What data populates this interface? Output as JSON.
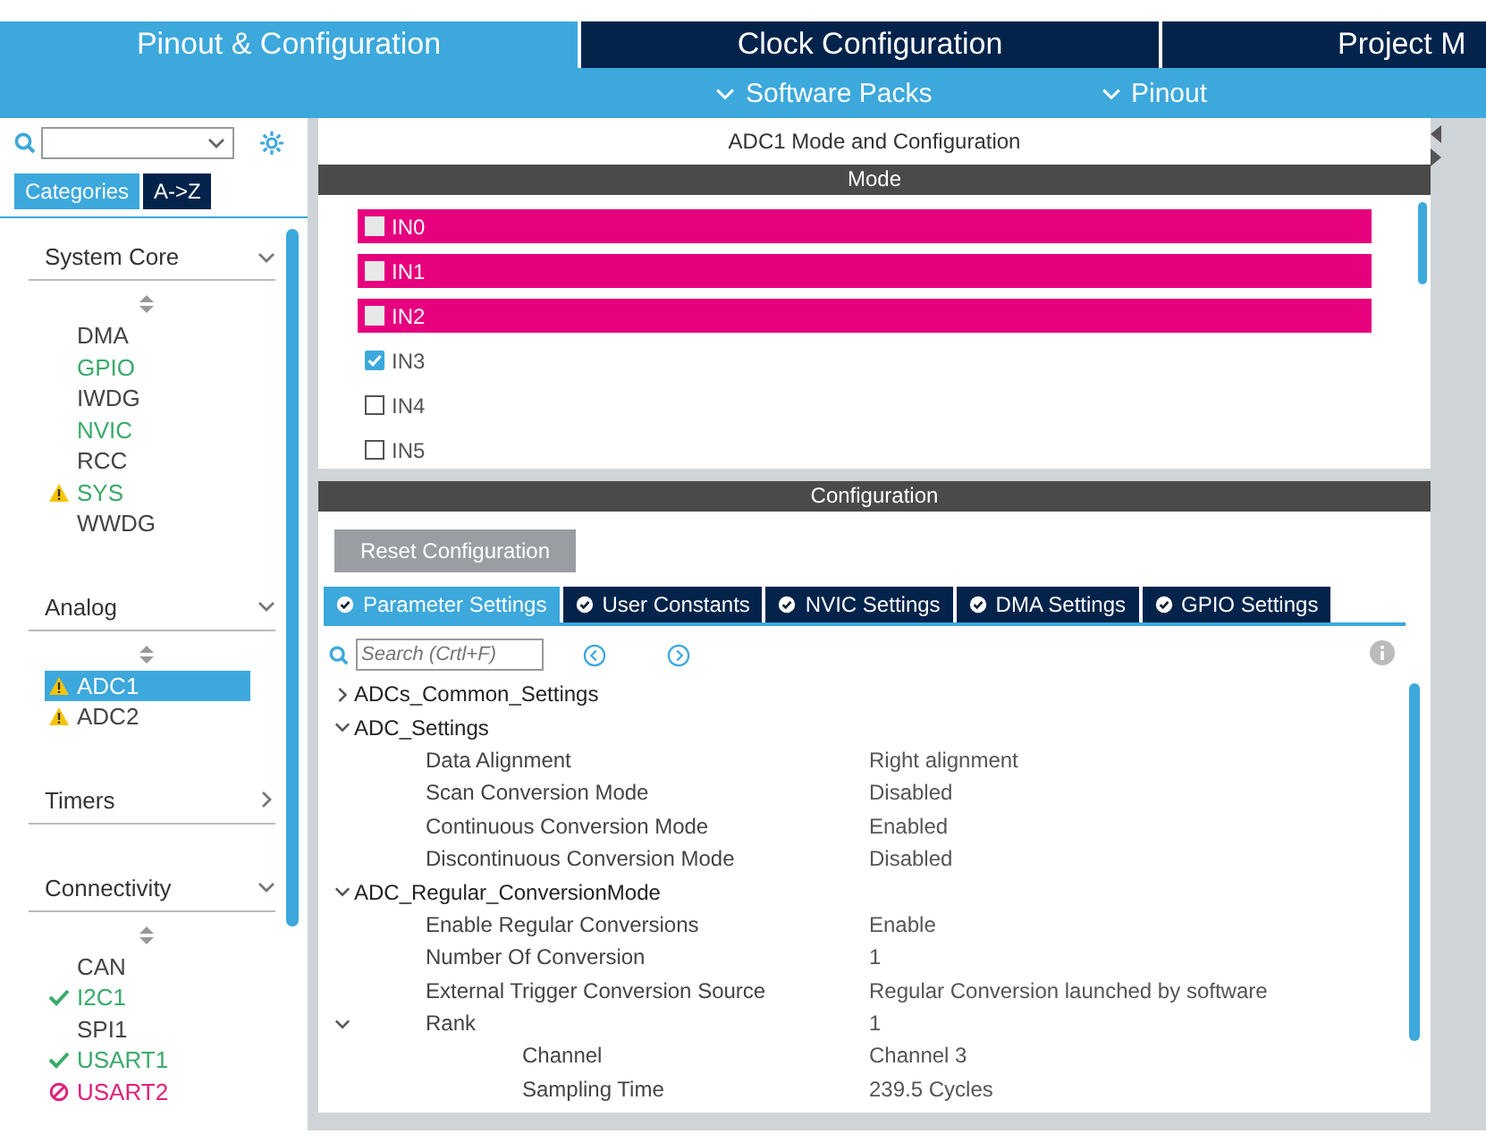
{
  "top_tabs": [
    {
      "label": "Pinout & Configuration",
      "selected": true
    },
    {
      "label": "Clock Configuration",
      "selected": false
    },
    {
      "label": "Project M",
      "selected": false
    }
  ],
  "sub_menu": [
    "Software Packs",
    "Pinout"
  ],
  "sidebar": {
    "view_tabs": [
      {
        "label": "Categories",
        "selected": true
      },
      {
        "label": "A->Z",
        "selected": false
      }
    ],
    "groups": [
      {
        "title": "System Core",
        "expanded": true,
        "items": [
          {
            "label": "DMA",
            "kind": "plain",
            "color": "#444444",
            "selected": false
          },
          {
            "label": "GPIO",
            "kind": "plain",
            "color": "#3aaa6a",
            "selected": false
          },
          {
            "label": "IWDG",
            "kind": "plain",
            "color": "#444444",
            "selected": false
          },
          {
            "label": "NVIC",
            "kind": "plain",
            "color": "#3aaa6a",
            "selected": false
          },
          {
            "label": "RCC",
            "kind": "plain",
            "color": "#444444",
            "selected": false
          },
          {
            "label": "SYS",
            "kind": "warning",
            "color": "#3aaa6a",
            "selected": false
          },
          {
            "label": "WWDG",
            "kind": "plain",
            "color": "#444444",
            "selected": false
          }
        ]
      },
      {
        "title": "Analog",
        "expanded": true,
        "items": [
          {
            "label": "ADC1",
            "kind": "warning",
            "color": "#ffffff",
            "selected": true
          },
          {
            "label": "ADC2",
            "kind": "warning",
            "color": "#444444",
            "selected": false
          }
        ]
      },
      {
        "title": "Timers",
        "expanded": false
      },
      {
        "title": "Connectivity",
        "expanded": true,
        "items": [
          {
            "label": "CAN",
            "kind": "plain",
            "color": "#444444",
            "selected": false
          },
          {
            "label": "I2C1",
            "kind": "ok",
            "color": "#3aaa6a",
            "selected": false
          },
          {
            "label": "SPI1",
            "kind": "plain",
            "color": "#444444",
            "selected": false
          },
          {
            "label": "USART1",
            "kind": "ok",
            "color": "#3aaa6a",
            "selected": false
          },
          {
            "label": "USART2",
            "kind": "error",
            "color": "#e0207a",
            "selected": false
          }
        ]
      }
    ]
  },
  "panel_title": "ADC1 Mode and Configuration",
  "mode": {
    "title": "Mode",
    "inputs": [
      {
        "label": "IN0",
        "checked": false,
        "highlighted": true
      },
      {
        "label": "IN1",
        "checked": false,
        "highlighted": true
      },
      {
        "label": "IN2",
        "checked": false,
        "highlighted": true
      },
      {
        "label": "IN3",
        "checked": true,
        "highlighted": false
      },
      {
        "label": "IN4",
        "checked": false,
        "highlighted": false
      },
      {
        "label": "IN5",
        "checked": false,
        "highlighted": false
      }
    ]
  },
  "configuration": {
    "title": "Configuration",
    "reset_button": "Reset Configuration",
    "tabs": [
      {
        "label": "Parameter Settings",
        "selected": true
      },
      {
        "label": "User Constants",
        "selected": false
      },
      {
        "label": "NVIC Settings",
        "selected": false
      },
      {
        "label": "DMA Settings",
        "selected": false
      },
      {
        "label": "GPIO Settings",
        "selected": false
      }
    ],
    "search": {
      "placeholder": "Search (Crtl+F)"
    },
    "parameters": [
      {
        "label": "ADCs_Common_Settings",
        "expanded": false
      },
      {
        "label": "ADC_Settings",
        "expanded": true,
        "children": [
          {
            "label": "Data Alignment",
            "value": "Right alignment"
          },
          {
            "label": "Scan Conversion Mode",
            "value": "Disabled"
          },
          {
            "label": "Continuous Conversion Mode",
            "value": "Enabled"
          },
          {
            "label": "Discontinuous Conversion Mode",
            "value": "Disabled"
          }
        ]
      },
      {
        "label": "ADC_Regular_ConversionMode",
        "expanded": true,
        "children": [
          {
            "label": "Enable Regular Conversions",
            "value": "Enable"
          },
          {
            "label": "Number Of Conversion",
            "value": "1"
          },
          {
            "label": "External Trigger Conversion Source",
            "value": "Regular Conversion launched by software"
          },
          {
            "label": "Rank",
            "value": "1",
            "expanded": true,
            "children": [
              {
                "label": "Channel",
                "value": "Channel 3"
              },
              {
                "label": "Sampling Time",
                "value": "239.5 Cycles"
              }
            ]
          }
        ]
      }
    ]
  }
}
